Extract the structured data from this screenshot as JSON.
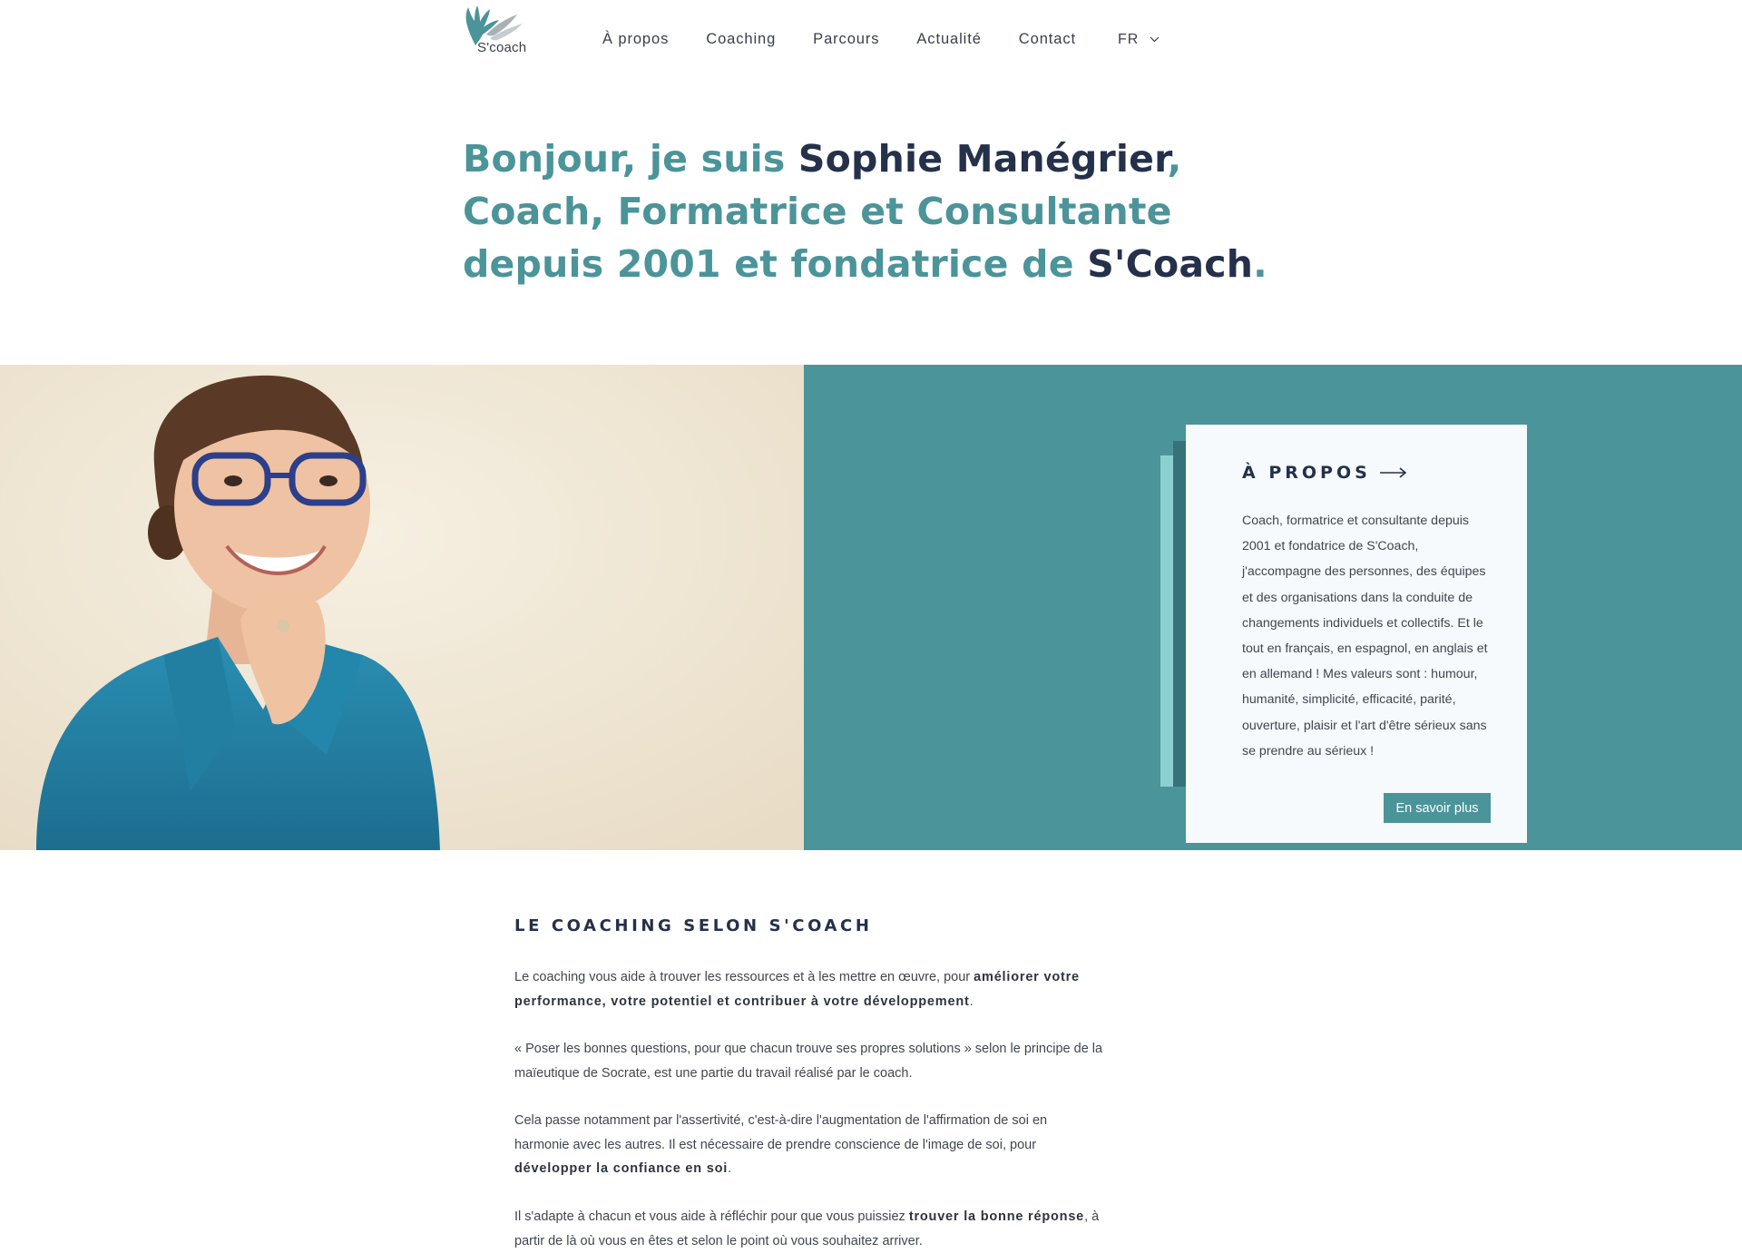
{
  "header": {
    "logo_text": "S'coach",
    "nav": [
      "À propos",
      "Coaching",
      "Parcours",
      "Actualité",
      "Contact"
    ],
    "language": "FR"
  },
  "hero": {
    "parts": [
      "Bonjour, je suis ",
      "Sophie Manégrier",
      ", Coach, Formatrice et Consultante depuis 2001 et fondatrice de ",
      "S'Coach",
      "."
    ]
  },
  "about_card": {
    "title": "À PROPOS",
    "body": "Coach, formatrice et consultante depuis 2001 et fondatrice de S'Coach, j'accompagne des personnes, des équipes et des organisations dans la conduite de changements individuels et collectifs. Et le tout en français, en espagnol, en anglais et en allemand ! Mes valeurs sont : humour, humanité, simplicité, efficacité, parité, ouverture, plaisir et l'art d'être sérieux sans se prendre au sérieux !",
    "button": "En savoir plus"
  },
  "coaching": {
    "title": "LE COACHING SELON S'COACH",
    "p1": [
      "Le coaching vous aide à trouver les ressources et à les mettre en œuvre, pour ",
      "améliorer votre performance, votre potentiel et contribuer à votre développement",
      "."
    ],
    "p2": "« Poser les bonnes questions, pour que chacun trouve ses propres solutions » selon le principe de la maïeutique de Socrate, est une partie du travail réalisé par le coach.",
    "p3": [
      "Cela passe notamment par l'assertivité, c'est-à-dire l'augmentation de l'affirmation de soi en harmonie avec les autres. Il est nécessaire de prendre conscience de l'image de soi, pour ",
      "développer la confiance en soi",
      "."
    ],
    "p4": [
      "Il s'adapte à chacun et vous aide à réfléchir pour que vous puissiez ",
      "trouver la bonne réponse",
      ", à partir de là où vous en êtes et selon le point où vous souhaitez arriver."
    ]
  },
  "colors": {
    "teal": "#4b9499",
    "navy": "#25304a",
    "accent_light": "#8ccfd0",
    "accent_dark": "#36727a"
  }
}
